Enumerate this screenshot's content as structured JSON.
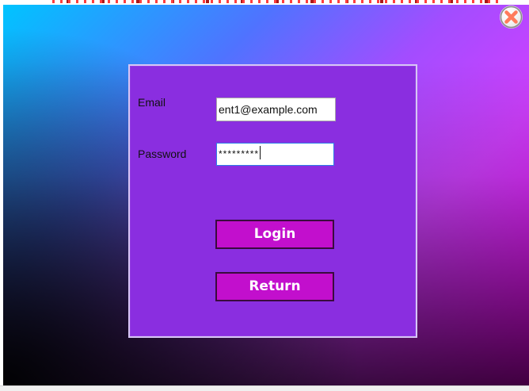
{
  "window": {
    "close_icon": "close-icon"
  },
  "form": {
    "email_label": "Email",
    "email_value": "ent1@example.com",
    "password_label": "Password",
    "password_value": "*********",
    "login_label": "Login",
    "return_label": "Return"
  },
  "colors": {
    "panel": "#8a2ee0",
    "button": "#c20fcd",
    "input_focus_border": "#2f7fe8"
  }
}
